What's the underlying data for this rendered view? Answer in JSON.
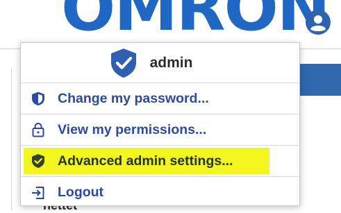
{
  "brand": {
    "logo_text": "OMRON",
    "color": "#2167c4"
  },
  "colors": {
    "menu_text": "#2d4aa0",
    "highlight": "#f2f51e",
    "header_band": "#3167ad"
  },
  "background": {
    "partial_text": "nettet"
  },
  "account_menu": {
    "user": {
      "name": "admin",
      "icon": "shield-check-icon"
    },
    "items": [
      {
        "label": "Change my password...",
        "icon": "shield-icon"
      },
      {
        "label": "View my permissions...",
        "icon": "lock-icon"
      },
      {
        "label": "Advanced admin settings...",
        "icon": "shield-check-icon",
        "highlighted": true
      },
      {
        "label": "Logout",
        "icon": "logout-icon"
      }
    ]
  }
}
